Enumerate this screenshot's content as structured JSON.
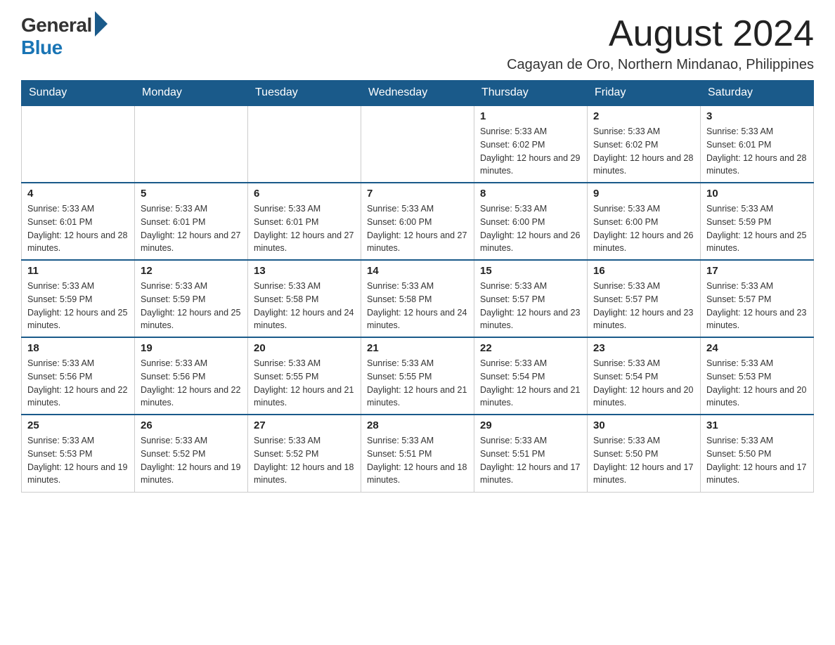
{
  "header": {
    "logo_general": "General",
    "logo_blue": "Blue",
    "month_title": "August 2024",
    "subtitle": "Cagayan de Oro, Northern Mindanao, Philippines"
  },
  "days_of_week": [
    "Sunday",
    "Monday",
    "Tuesday",
    "Wednesday",
    "Thursday",
    "Friday",
    "Saturday"
  ],
  "weeks": [
    {
      "days": [
        {
          "num": "",
          "info": ""
        },
        {
          "num": "",
          "info": ""
        },
        {
          "num": "",
          "info": ""
        },
        {
          "num": "",
          "info": ""
        },
        {
          "num": "1",
          "info": "Sunrise: 5:33 AM\nSunset: 6:02 PM\nDaylight: 12 hours and 29 minutes."
        },
        {
          "num": "2",
          "info": "Sunrise: 5:33 AM\nSunset: 6:02 PM\nDaylight: 12 hours and 28 minutes."
        },
        {
          "num": "3",
          "info": "Sunrise: 5:33 AM\nSunset: 6:01 PM\nDaylight: 12 hours and 28 minutes."
        }
      ]
    },
    {
      "days": [
        {
          "num": "4",
          "info": "Sunrise: 5:33 AM\nSunset: 6:01 PM\nDaylight: 12 hours and 28 minutes."
        },
        {
          "num": "5",
          "info": "Sunrise: 5:33 AM\nSunset: 6:01 PM\nDaylight: 12 hours and 27 minutes."
        },
        {
          "num": "6",
          "info": "Sunrise: 5:33 AM\nSunset: 6:01 PM\nDaylight: 12 hours and 27 minutes."
        },
        {
          "num": "7",
          "info": "Sunrise: 5:33 AM\nSunset: 6:00 PM\nDaylight: 12 hours and 27 minutes."
        },
        {
          "num": "8",
          "info": "Sunrise: 5:33 AM\nSunset: 6:00 PM\nDaylight: 12 hours and 26 minutes."
        },
        {
          "num": "9",
          "info": "Sunrise: 5:33 AM\nSunset: 6:00 PM\nDaylight: 12 hours and 26 minutes."
        },
        {
          "num": "10",
          "info": "Sunrise: 5:33 AM\nSunset: 5:59 PM\nDaylight: 12 hours and 25 minutes."
        }
      ]
    },
    {
      "days": [
        {
          "num": "11",
          "info": "Sunrise: 5:33 AM\nSunset: 5:59 PM\nDaylight: 12 hours and 25 minutes."
        },
        {
          "num": "12",
          "info": "Sunrise: 5:33 AM\nSunset: 5:59 PM\nDaylight: 12 hours and 25 minutes."
        },
        {
          "num": "13",
          "info": "Sunrise: 5:33 AM\nSunset: 5:58 PM\nDaylight: 12 hours and 24 minutes."
        },
        {
          "num": "14",
          "info": "Sunrise: 5:33 AM\nSunset: 5:58 PM\nDaylight: 12 hours and 24 minutes."
        },
        {
          "num": "15",
          "info": "Sunrise: 5:33 AM\nSunset: 5:57 PM\nDaylight: 12 hours and 23 minutes."
        },
        {
          "num": "16",
          "info": "Sunrise: 5:33 AM\nSunset: 5:57 PM\nDaylight: 12 hours and 23 minutes."
        },
        {
          "num": "17",
          "info": "Sunrise: 5:33 AM\nSunset: 5:57 PM\nDaylight: 12 hours and 23 minutes."
        }
      ]
    },
    {
      "days": [
        {
          "num": "18",
          "info": "Sunrise: 5:33 AM\nSunset: 5:56 PM\nDaylight: 12 hours and 22 minutes."
        },
        {
          "num": "19",
          "info": "Sunrise: 5:33 AM\nSunset: 5:56 PM\nDaylight: 12 hours and 22 minutes."
        },
        {
          "num": "20",
          "info": "Sunrise: 5:33 AM\nSunset: 5:55 PM\nDaylight: 12 hours and 21 minutes."
        },
        {
          "num": "21",
          "info": "Sunrise: 5:33 AM\nSunset: 5:55 PM\nDaylight: 12 hours and 21 minutes."
        },
        {
          "num": "22",
          "info": "Sunrise: 5:33 AM\nSunset: 5:54 PM\nDaylight: 12 hours and 21 minutes."
        },
        {
          "num": "23",
          "info": "Sunrise: 5:33 AM\nSunset: 5:54 PM\nDaylight: 12 hours and 20 minutes."
        },
        {
          "num": "24",
          "info": "Sunrise: 5:33 AM\nSunset: 5:53 PM\nDaylight: 12 hours and 20 minutes."
        }
      ]
    },
    {
      "days": [
        {
          "num": "25",
          "info": "Sunrise: 5:33 AM\nSunset: 5:53 PM\nDaylight: 12 hours and 19 minutes."
        },
        {
          "num": "26",
          "info": "Sunrise: 5:33 AM\nSunset: 5:52 PM\nDaylight: 12 hours and 19 minutes."
        },
        {
          "num": "27",
          "info": "Sunrise: 5:33 AM\nSunset: 5:52 PM\nDaylight: 12 hours and 18 minutes."
        },
        {
          "num": "28",
          "info": "Sunrise: 5:33 AM\nSunset: 5:51 PM\nDaylight: 12 hours and 18 minutes."
        },
        {
          "num": "29",
          "info": "Sunrise: 5:33 AM\nSunset: 5:51 PM\nDaylight: 12 hours and 17 minutes."
        },
        {
          "num": "30",
          "info": "Sunrise: 5:33 AM\nSunset: 5:50 PM\nDaylight: 12 hours and 17 minutes."
        },
        {
          "num": "31",
          "info": "Sunrise: 5:33 AM\nSunset: 5:50 PM\nDaylight: 12 hours and 17 minutes."
        }
      ]
    }
  ]
}
